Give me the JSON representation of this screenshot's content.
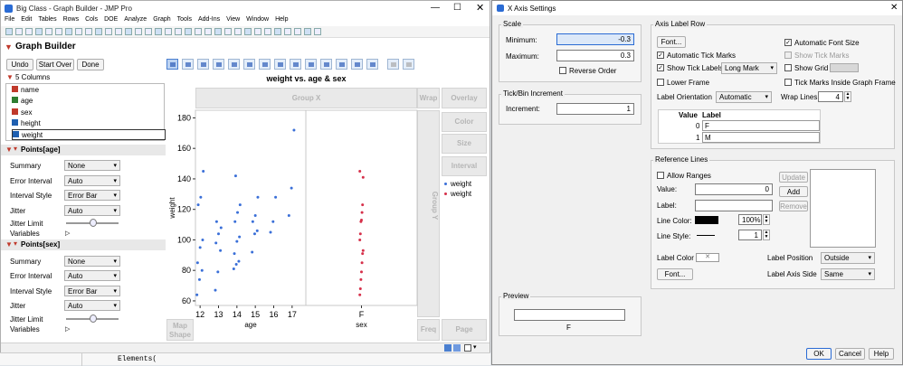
{
  "window": {
    "title": "Big Class - Graph Builder - JMP Pro"
  },
  "menu": [
    "File",
    "Edit",
    "Tables",
    "Rows",
    "Cols",
    "DOE",
    "Analyze",
    "Graph",
    "Tools",
    "Add-Ins",
    "View",
    "Window",
    "Help"
  ],
  "gb": {
    "title": "Graph Builder",
    "buttons": {
      "undo": "Undo",
      "start_over": "Start Over",
      "done": "Done"
    },
    "columns_header": "5 Columns",
    "columns": [
      {
        "name": "name",
        "color": "#c0392b"
      },
      {
        "name": "age",
        "color": "#2e7d32"
      },
      {
        "name": "sex",
        "color": "#c0392b"
      },
      {
        "name": "height",
        "color": "#1f5fb0"
      },
      {
        "name": "weight",
        "color": "#1f5fb0"
      }
    ],
    "sections": [
      {
        "title": "Points[age]",
        "summary": "None",
        "error_interval": "Auto",
        "interval_style": "Error Bar",
        "jitter": "Auto"
      },
      {
        "title": "Points[sex]",
        "summary": "None",
        "error_interval": "Auto",
        "interval_style": "Error Bar",
        "jitter": "Auto"
      }
    ],
    "labels": {
      "summary": "Summary",
      "error_interval": "Error Interval",
      "interval_style": "Interval Style",
      "jitter": "Jitter",
      "jitter_limit": "Jitter Limit",
      "variables": "Variables"
    },
    "zones": {
      "group_x": "Group X",
      "group_y": "Group Y",
      "wrap": "Wrap",
      "overlay": "Overlay",
      "color": "Color",
      "size": "Size",
      "interval": "Interval",
      "map_shape": "Map Shape",
      "freq": "Freq",
      "page": "Page"
    },
    "legend": [
      {
        "label": "weight",
        "color": "#3a6fd8"
      },
      {
        "label": "weight",
        "color": "#d6304a"
      }
    ],
    "code_text": "Elements("
  },
  "chart_data": [
    {
      "type": "scatter",
      "title": "weight vs. age & sex",
      "ylabel": "weight",
      "ylim": [
        57,
        185
      ],
      "yticks": [
        60,
        80,
        100,
        120,
        140,
        160,
        180
      ],
      "color": "#3a6fd8",
      "xlabel": "age",
      "categories": [
        "12",
        "13",
        "14",
        "15",
        "16",
        "17"
      ],
      "points": [
        {
          "x": "12",
          "y": [
            64,
            74,
            80,
            85,
            95,
            100,
            123,
            128,
            145
          ]
        },
        {
          "x": "13",
          "y": [
            67,
            79,
            93,
            98,
            104,
            108,
            112
          ]
        },
        {
          "x": "14",
          "y": [
            81,
            84,
            86,
            91,
            99,
            102,
            112,
            118,
            123,
            142
          ]
        },
        {
          "x": "15",
          "y": [
            92,
            104,
            106,
            112,
            116,
            128
          ]
        },
        {
          "x": "16",
          "y": [
            105,
            112,
            128
          ]
        },
        {
          "x": "17",
          "y": [
            116,
            134,
            172
          ]
        }
      ]
    },
    {
      "type": "scatter",
      "xlabel": "sex",
      "color": "#d6304a",
      "categories": [
        "F"
      ],
      "points": [
        {
          "x": "F",
          "y": [
            64,
            68,
            74,
            79,
            85,
            91,
            93,
            100,
            104,
            112,
            113,
            118,
            123,
            141,
            145
          ]
        }
      ]
    }
  ],
  "dialog": {
    "title": "X Axis Settings",
    "scale": {
      "title": "Scale",
      "min_label": "Minimum:",
      "min": "-0.3",
      "max_label": "Maximum:",
      "max": "0.3",
      "reverse": "Reverse Order"
    },
    "tick": {
      "title": "Tick/Bin Increment",
      "inc_label": "Increment:",
      "inc": "1"
    },
    "preview": {
      "title": "Preview",
      "value": "F"
    },
    "axis_label_row": {
      "title": "Axis Label Row",
      "font": "Font...",
      "auto_font": "Automatic Font Size",
      "auto_tick": "Automatic Tick Marks",
      "show_tick_marks": "Show Tick Marks",
      "show_tick_labels": "Show Tick Labels",
      "long_mark": "Long Mark",
      "show_grid": "Show Grid",
      "lower_frame": "Lower Frame",
      "tick_inside": "Tick Marks Inside Graph Frame",
      "orientation_label": "Label Orientation",
      "orientation": "Automatic",
      "wrap_label": "Wrap Lines",
      "wrap": "4",
      "table_headers": [
        "Value",
        "Label"
      ],
      "rows": [
        {
          "value": "0",
          "label": "F"
        },
        {
          "value": "1",
          "label": "M"
        }
      ]
    },
    "ref": {
      "title": "Reference Lines",
      "allow_ranges": "Allow Ranges",
      "value_label": "Value:",
      "value": "0",
      "label_label": "Label:",
      "update": "Update",
      "add": "Add",
      "remove": "Remove",
      "line_color": "Line Color:",
      "pct": "100%",
      "line_style": "Line Style:",
      "style_val": "1",
      "label_color": "Label Color",
      "label_position_label": "Label Position",
      "label_position": "Outside",
      "font": "Font...",
      "label_axis_side_label": "Label Axis Side",
      "label_axis_side": "Same"
    },
    "buttons": {
      "ok": "OK",
      "cancel": "Cancel",
      "help": "Help"
    }
  }
}
